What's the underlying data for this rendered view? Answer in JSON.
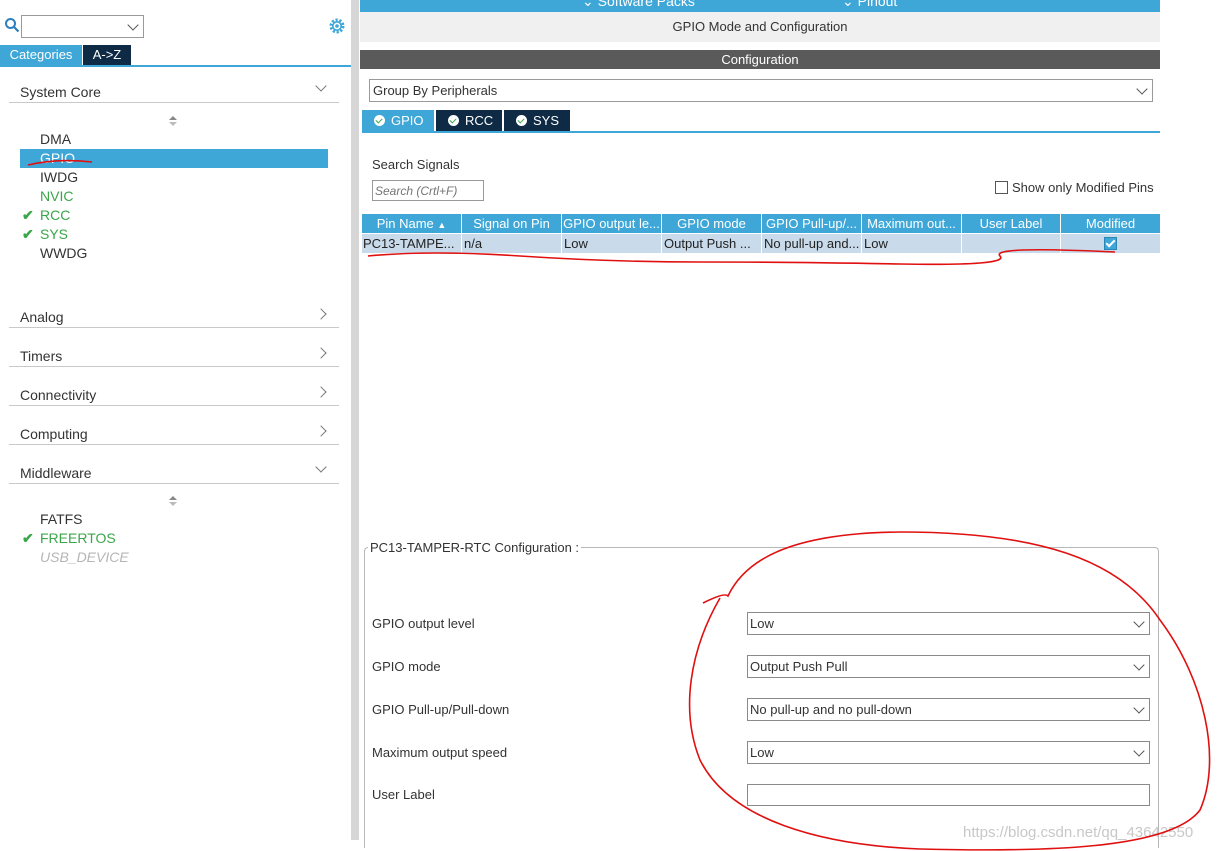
{
  "top": {
    "tabs": [
      "Software Packs",
      "Pinout"
    ]
  },
  "left": {
    "tabs": {
      "categories": "Categories",
      "az": "A->Z"
    },
    "sections": {
      "system_core": {
        "title": "System Core",
        "items": [
          {
            "name": "DMA",
            "state": "normal"
          },
          {
            "name": "GPIO",
            "state": "selected"
          },
          {
            "name": "IWDG",
            "state": "normal"
          },
          {
            "name": "NVIC",
            "state": "green"
          },
          {
            "name": "RCC",
            "state": "checked"
          },
          {
            "name": "SYS",
            "state": "checked"
          },
          {
            "name": "WWDG",
            "state": "normal"
          }
        ]
      },
      "analog": {
        "title": "Analog"
      },
      "timers": {
        "title": "Timers"
      },
      "connectivity": {
        "title": "Connectivity"
      },
      "computing": {
        "title": "Computing"
      },
      "middleware": {
        "title": "Middleware",
        "items": [
          {
            "name": "FATFS",
            "state": "normal"
          },
          {
            "name": "FREERTOS",
            "state": "checked"
          },
          {
            "name": "USB_DEVICE",
            "state": "disabled"
          }
        ]
      }
    }
  },
  "main": {
    "title": "GPIO Mode and Configuration",
    "config_header": "Configuration",
    "group_by": "Group By Peripherals",
    "tabs": [
      "GPIO",
      "RCC",
      "SYS"
    ],
    "search_label": "Search Signals",
    "search_placeholder": "Search (Crtl+F)",
    "show_modified": "Show only Modified Pins",
    "table": {
      "headers": [
        "Pin Name",
        "Signal on Pin",
        "GPIO output le...",
        "GPIO mode",
        "GPIO Pull-up/...",
        "Maximum out...",
        "User Label",
        "Modified"
      ],
      "rows": [
        {
          "pin": "PC13-TAMPE...",
          "signal": "n/a",
          "level": "Low",
          "mode": "Output Push ...",
          "pull": "No pull-up and...",
          "speed": "Low",
          "label": "",
          "modified": true
        }
      ]
    },
    "pin_config": {
      "title": "PC13-TAMPER-RTC Configuration :",
      "fields": [
        {
          "label": "GPIO output level",
          "value": "Low"
        },
        {
          "label": "GPIO mode",
          "value": "Output Push Pull"
        },
        {
          "label": "GPIO Pull-up/Pull-down",
          "value": "No pull-up and no pull-down"
        },
        {
          "label": "Maximum output speed",
          "value": "Low"
        },
        {
          "label": "User Label",
          "value": ""
        }
      ]
    }
  },
  "watermark": "https://blog.csdn.net/qq_43642550",
  "colors": {
    "accent": "#3ea7d8",
    "enabled": "#3aa64a",
    "annotation": "#e01010"
  }
}
